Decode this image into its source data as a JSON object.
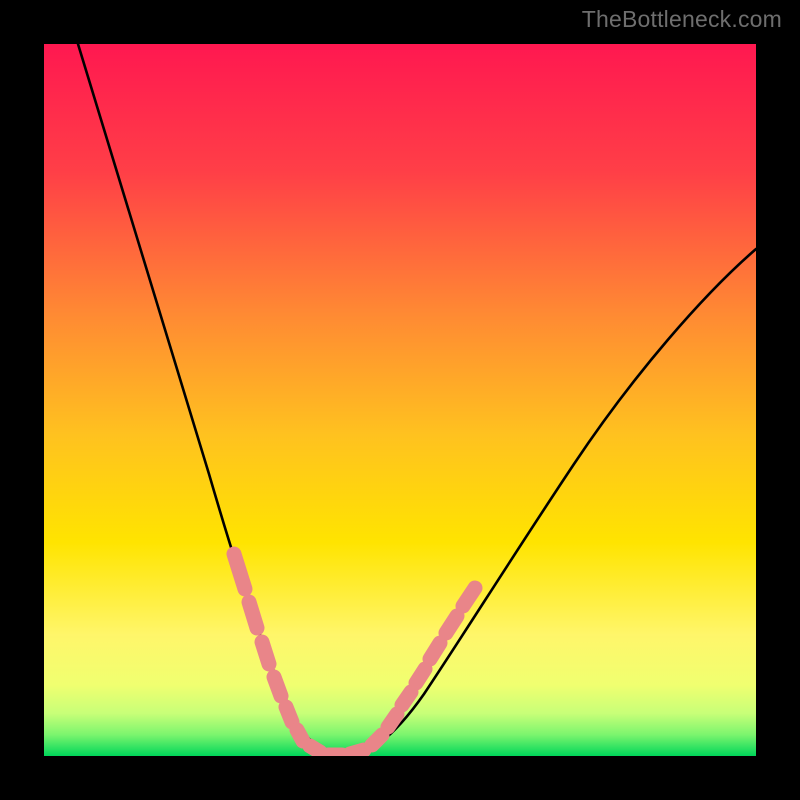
{
  "watermark": {
    "text": "TheBottleneck.com"
  },
  "chart_data": {
    "type": "line",
    "title": "",
    "xlabel": "",
    "ylabel": "",
    "xlim": [
      0,
      100
    ],
    "ylim": [
      0,
      100
    ],
    "series": [
      {
        "name": "bottleneck-curve",
        "x": [
          3,
          5,
          8,
          11,
          14,
          17,
          20,
          23,
          26,
          28,
          30,
          32,
          34,
          36,
          38,
          40,
          43,
          46,
          50,
          55,
          60,
          65,
          70,
          75,
          80,
          85,
          90,
          95,
          100
        ],
        "values": [
          100,
          92,
          82,
          73,
          65,
          57,
          49,
          41,
          33,
          27,
          21,
          15,
          9,
          4,
          1,
          0,
          1,
          5,
          11,
          19,
          27,
          34,
          41,
          47,
          53,
          58,
          63,
          67,
          71
        ]
      },
      {
        "name": "sample-markers",
        "x": [
          26,
          27,
          28,
          29,
          30,
          31,
          32,
          33,
          34,
          35,
          36,
          37,
          38,
          39,
          40,
          41,
          42,
          43,
          44,
          45,
          46,
          47,
          48,
          49,
          50,
          51,
          52
        ],
        "values": [
          33,
          30,
          27,
          24,
          21,
          18,
          15,
          12,
          9,
          6,
          4,
          2,
          1,
          0,
          0,
          0,
          1,
          2,
          3,
          5,
          7,
          9,
          11,
          13,
          16,
          19,
          22
        ]
      }
    ],
    "background_gradient": {
      "top": "#ff1a4d",
      "mid1": "#ff7a33",
      "mid2": "#ffd400",
      "mid3": "#fff176",
      "bottom": "#00d65a"
    },
    "grid": false,
    "legend": false
  }
}
